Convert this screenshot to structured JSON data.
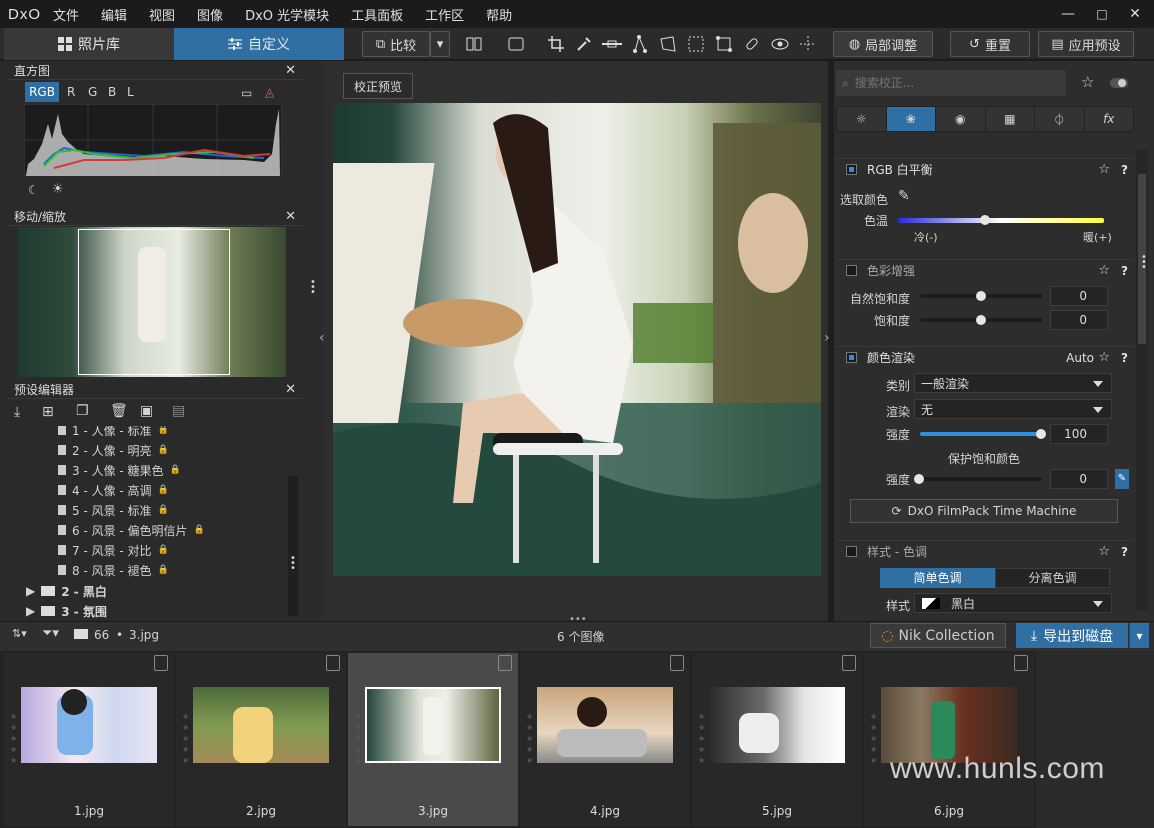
{
  "menubar": {
    "logo": "DxO",
    "items": [
      "文件",
      "编辑",
      "视图",
      "图像",
      "DxO 光学模块",
      "工具面板",
      "工作区",
      "帮助"
    ]
  },
  "window_controls": {
    "minimize": "—",
    "maximize": "□",
    "close": "✕"
  },
  "toolbar": {
    "tab_library": "照片库",
    "tab_customize": "自定义",
    "compare": "比较",
    "local_adjust": "局部调整",
    "reset": "重置",
    "apply_preset": "应用预设"
  },
  "histogram": {
    "title": "直方图",
    "channels": [
      "RGB",
      "R",
      "G",
      "B",
      "L"
    ]
  },
  "navigator": {
    "title": "移动/缩放"
  },
  "presets": {
    "title": "预设编辑器",
    "items": [
      "1 - 人像 - 标准",
      "2 - 人像 - 明亮",
      "3 - 人像 - 糖果色",
      "4 - 人像 - 高调",
      "5 - 风景 - 标准",
      "6 - 风景 - 偏色明信片",
      "7 - 风景 - 对比",
      "8 - 风景 - 褪色"
    ],
    "folders": [
      "2 - 黑白",
      "3 - 氛围"
    ]
  },
  "center": {
    "preview_btn": "校正预览"
  },
  "right": {
    "search_placeholder": "搜索校正...",
    "wb": {
      "title": "RGB 白平衡",
      "pick": "选取颜色",
      "temp": "色温",
      "cold": "冷(-)",
      "warm": "暖(+)",
      "temp_level": 0.42
    },
    "boost": {
      "title": "色彩增强",
      "vibrancy": "自然饱和度",
      "saturation": "饱和度",
      "vib_val": "0",
      "sat_val": "0"
    },
    "render": {
      "title": "颜色渲染",
      "auto": "Auto",
      "category_lbl": "类别",
      "category": "一般渲染",
      "render_lbl": "渲染",
      "render": "无",
      "strength_lbl": "强度",
      "strength": "100",
      "protect": "保护饱和颜色",
      "protect_strength_lbl": "强度",
      "protect_val": "0",
      "filmpack": "DxO FilmPack Time Machine"
    },
    "style": {
      "title": "样式 - 色调",
      "simple": "简单色调",
      "split": "分离色调",
      "style_lbl": "样式",
      "style_val": "黑白"
    }
  },
  "status": {
    "folder_count": "66",
    "filename": "3.jpg",
    "count": "6 个图像",
    "nik": "Nik Collection",
    "export": "导出到磁盘"
  },
  "filmstrip": [
    "1.jpg",
    "2.jpg",
    "3.jpg",
    "4.jpg",
    "5.jpg",
    "6.jpg"
  ],
  "watermark": "www.hunls.com"
}
